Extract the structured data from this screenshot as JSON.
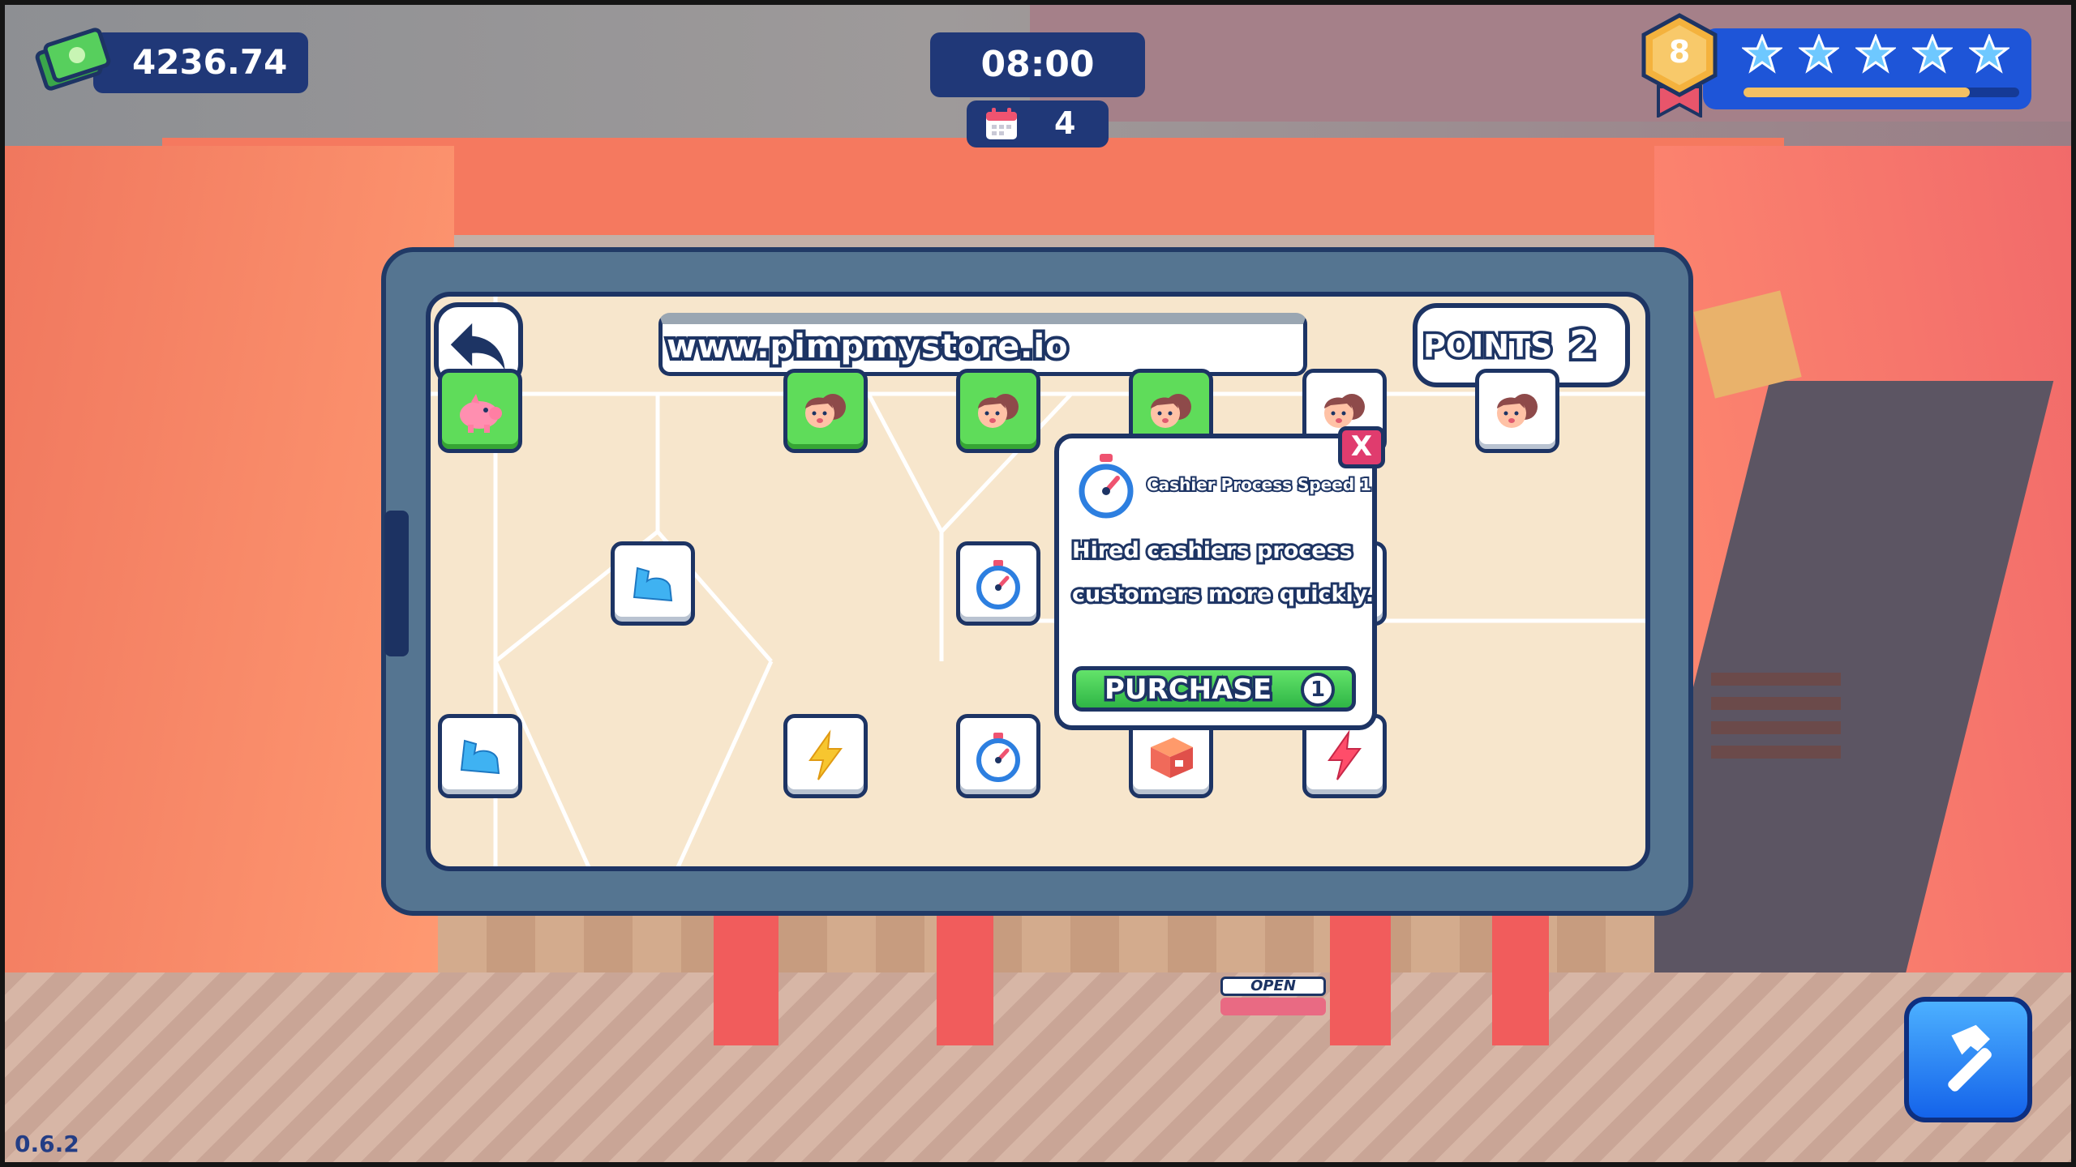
{
  "hud": {
    "money": "4236.74",
    "clock": "08:00",
    "day": "4",
    "level": "8",
    "stars": [
      "star-icon",
      "star-icon",
      "star-icon",
      "star-icon",
      "star-icon"
    ],
    "xp_progress": 0.82,
    "version": "0.6.2"
  },
  "phone": {
    "url": "www.pimpmystore.io",
    "points_label": "POINTS",
    "points_value": "2"
  },
  "skill_tree": {
    "nodes": [
      {
        "icon": "piggy-bank-icon",
        "state": "unlocked"
      },
      {
        "icon": "cashier-icon",
        "state": "unlocked"
      },
      {
        "icon": "cashier-icon",
        "state": "unlocked"
      },
      {
        "icon": "cashier-icon",
        "state": "unlocked"
      },
      {
        "icon": "cashier-icon",
        "state": "locked"
      },
      {
        "icon": "cashier-icon",
        "state": "locked"
      },
      {
        "icon": "strength-icon",
        "state": "locked"
      },
      {
        "icon": "stopwatch-icon",
        "state": "locked"
      },
      {
        "icon": "strength-icon",
        "state": "locked"
      },
      {
        "icon": "lightning-icon",
        "state": "locked"
      },
      {
        "icon": "stopwatch-icon",
        "state": "locked"
      },
      {
        "icon": "box-icon",
        "state": "locked"
      },
      {
        "icon": "lightning-icon",
        "state": "locked"
      }
    ]
  },
  "tooltip": {
    "title": "Cashier Process Speed 1",
    "desc_line1": "Hired cashiers process",
    "desc_line2": "customers more quickly.",
    "close_label": "X",
    "purchase_label": "PURCHASE",
    "purchase_cost": "1"
  },
  "colors": {
    "hud_navy": "#203878",
    "outline": "#1d3464",
    "unlocked_green": "#5fdc5a",
    "level_blue": "#1e55d8",
    "close_pink": "#e03c6e"
  }
}
